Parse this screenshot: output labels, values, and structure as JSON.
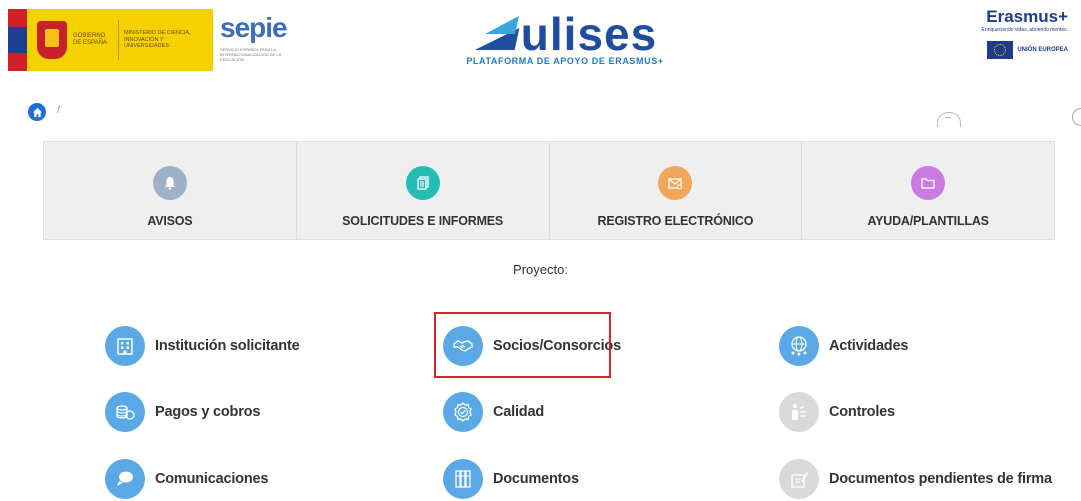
{
  "header": {
    "gov_logo_text": "Gobierno de España",
    "ministry_text": "Ministerio de Ciencia, Innovación y Universidades",
    "sepie_word": "sepie",
    "sepie_subtitle": "Servicio Español para la Internacionalización de la Educación",
    "app_name": "ulises",
    "app_subtitle": "PLATAFORMA DE APOYO DE ERASMUS+",
    "erasmus_word": "Erasmus+",
    "erasmus_tagline": "Enriqueciendo vidas, abriendo mentes.",
    "eu_text": "UNIÓN EUROPEA"
  },
  "breadcrumb": {
    "separator": "/"
  },
  "tiles": [
    {
      "label": "AVISOS",
      "icon": "bell-icon",
      "color": "#9fb1c8"
    },
    {
      "label": "SOLICITUDES E INFORMES",
      "icon": "documents-icon",
      "color": "#25bdb3"
    },
    {
      "label": "REGISTRO ELECTRÓNICO",
      "icon": "mail-icon",
      "color": "#f2a65a"
    },
    {
      "label": "AYUDA/PLANTILLAS",
      "icon": "folder-icon",
      "color": "#c97be2"
    }
  ],
  "project": {
    "heading": "Proyecto:",
    "items": [
      {
        "label": "Institución solicitante",
        "icon": "building-icon",
        "color": "#5aa9e6"
      },
      {
        "label": "Socios/Consorcios",
        "icon": "handshake-icon",
        "color": "#5aa9e6"
      },
      {
        "label": "Actividades",
        "icon": "globe-people-icon",
        "color": "#5aa9e6"
      },
      {
        "label": "Pagos y cobros",
        "icon": "coins-icon",
        "color": "#5aa9e6"
      },
      {
        "label": "Calidad",
        "icon": "quality-badge-icon",
        "color": "#5aa9e6"
      },
      {
        "label": "Controles",
        "icon": "checklist-person-icon",
        "color": "#d9d9d9"
      },
      {
        "label": "Comunicaciones",
        "icon": "chat-bubbles-icon",
        "color": "#5aa9e6"
      },
      {
        "label": "Documentos",
        "icon": "binders-icon",
        "color": "#5aa9e6"
      },
      {
        "label": "Documentos pendientes de firma",
        "icon": "sign-document-icon",
        "color": "#d9d9d9"
      }
    ]
  }
}
